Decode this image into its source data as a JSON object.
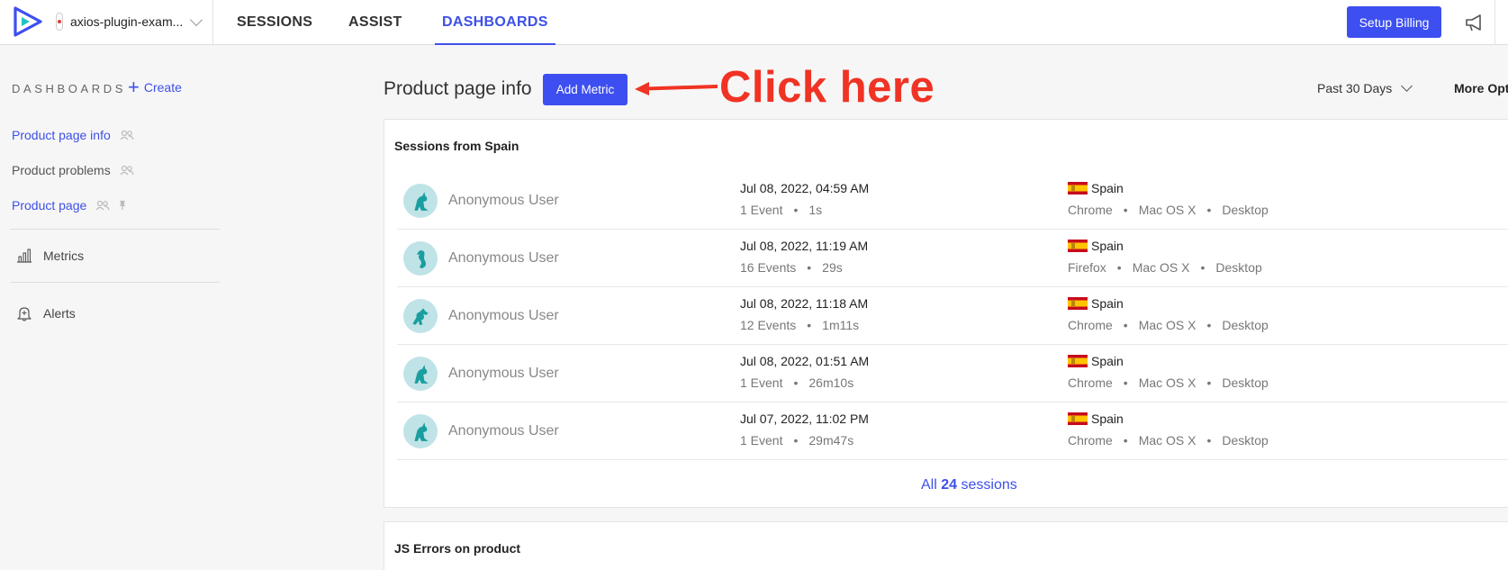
{
  "header": {
    "project_name": "axios-plugin-exam...",
    "nav": [
      "SESSIONS",
      "ASSIST",
      "DASHBOARDS"
    ],
    "active_nav": "DASHBOARDS",
    "billing_label": "Setup Billing",
    "accent_color": "#3d4ff0"
  },
  "sidebar": {
    "title": "DASHBOARDS",
    "create_label": "Create",
    "dashboards": [
      {
        "label": "Product page info",
        "shared": true,
        "pinned": false
      },
      {
        "label": "Product problems",
        "shared": true,
        "pinned": false
      },
      {
        "label": "Product page",
        "shared": true,
        "pinned": true
      }
    ],
    "metrics_label": "Metrics",
    "alerts_label": "Alerts"
  },
  "main": {
    "title": "Product page info",
    "add_metric_label": "Add Metric",
    "annotation_text": "Click here",
    "period_label": "Past 30 Days",
    "more_options_label": "More Opti"
  },
  "sessions_card": {
    "title": "Sessions from Spain",
    "rows": [
      {
        "avatar": "kangaroo-icon",
        "user": "Anonymous User",
        "date": "Jul 08, 2022, 04:59 AM",
        "events": "1 Event",
        "duration": "1s",
        "country": "Spain",
        "browser": "Chrome",
        "os": "Mac OS X",
        "device": "Desktop"
      },
      {
        "avatar": "seahorse-icon",
        "user": "Anonymous User",
        "date": "Jul 08, 2022, 11:19 AM",
        "events": "16 Events",
        "duration": "29s",
        "country": "Spain",
        "browser": "Firefox",
        "os": "Mac OS X",
        "device": "Desktop"
      },
      {
        "avatar": "horse-icon",
        "user": "Anonymous User",
        "date": "Jul 08, 2022, 11:18 AM",
        "events": "12 Events",
        "duration": "1m11s",
        "country": "Spain",
        "browser": "Chrome",
        "os": "Mac OS X",
        "device": "Desktop"
      },
      {
        "avatar": "kangaroo-icon",
        "user": "Anonymous User",
        "date": "Jul 08, 2022, 01:51 AM",
        "events": "1 Event",
        "duration": "26m10s",
        "country": "Spain",
        "browser": "Chrome",
        "os": "Mac OS X",
        "device": "Desktop"
      },
      {
        "avatar": "kangaroo-icon",
        "user": "Anonymous User",
        "date": "Jul 07, 2022, 11:02 PM",
        "events": "1 Event",
        "duration": "29m47s",
        "country": "Spain",
        "browser": "Chrome",
        "os": "Mac OS X",
        "device": "Desktop"
      }
    ],
    "all_prefix": "All",
    "all_count": "24",
    "all_suffix": "sessions"
  },
  "errors_card": {
    "title": "JS Errors on product"
  }
}
